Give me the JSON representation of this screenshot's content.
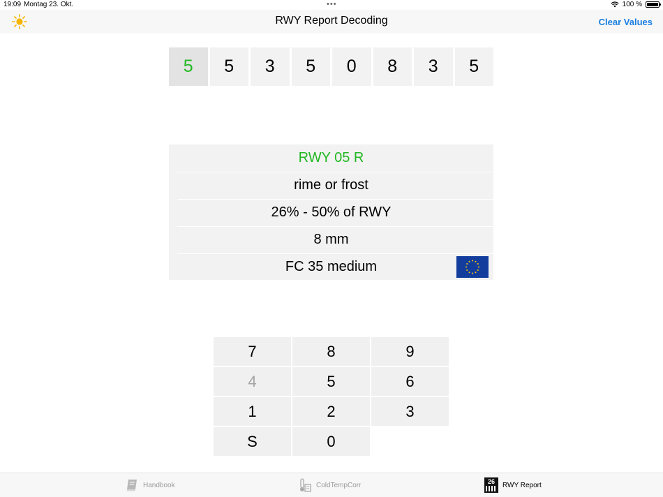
{
  "status": {
    "time": "19:09",
    "date": "Montag 23. Okt.",
    "battery": "100 %"
  },
  "nav": {
    "title": "RWY Report Decoding",
    "clear_label": "Clear Values"
  },
  "code_digits": [
    "5",
    "5",
    "3",
    "5",
    "0",
    "8",
    "3",
    "5"
  ],
  "decoded": {
    "runway": "RWY 05 R",
    "deposit": "rime or frost",
    "contamination": "26% - 50% of RWY",
    "depth": "8 mm",
    "friction": "FC 35 medium"
  },
  "keypad": {
    "k7": "7",
    "k8": "8",
    "k9": "9",
    "k4": "4",
    "k5": "5",
    "k6": "6",
    "k1": "1",
    "k2": "2",
    "k3": "3",
    "ks": "S",
    "k0": "0"
  },
  "tabs": {
    "handbook": "Handbook",
    "coldtemp": "ColdTempCorr",
    "rwyreport": "RWY Report",
    "rwyreport_icon_number": "26"
  },
  "colors": {
    "accent_blue": "#1a7fe0",
    "active_green": "#22b822",
    "eu_blue": "#123d9c",
    "eu_star": "#ffcc00"
  }
}
